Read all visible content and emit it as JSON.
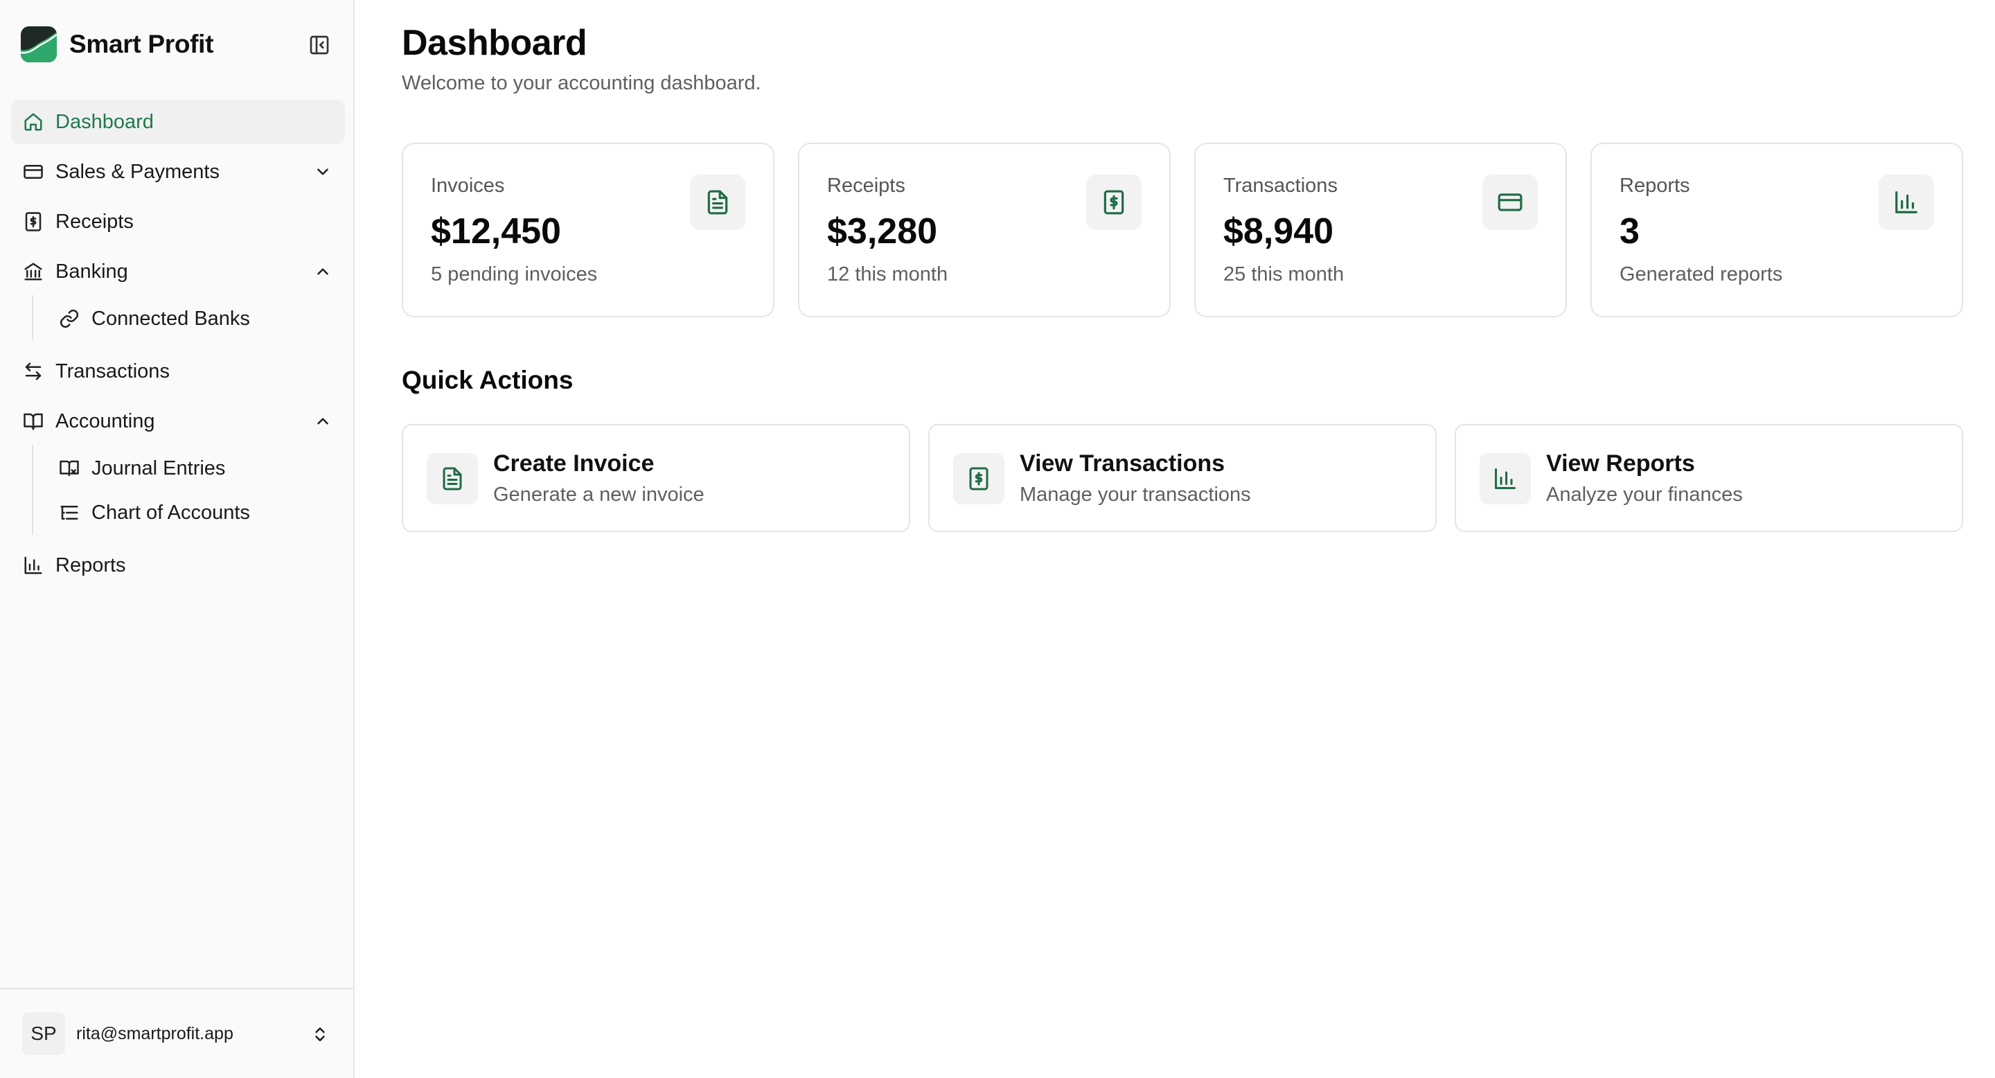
{
  "brand": {
    "name": "Smart Profit"
  },
  "colors": {
    "accent": "#1e7a4c",
    "icon": "#1e6b44",
    "border": "#e5e5e5"
  },
  "sidebar": {
    "items": [
      {
        "label": "Dashboard",
        "icon": "home-icon"
      },
      {
        "label": "Sales & Payments",
        "icon": "credit-card-icon"
      },
      {
        "label": "Receipts",
        "icon": "receipt-icon"
      },
      {
        "label": "Banking",
        "icon": "bank-icon"
      },
      {
        "label": "Connected Banks",
        "icon": "link-icon"
      },
      {
        "label": "Transactions",
        "icon": "arrows-exchange-icon"
      },
      {
        "label": "Accounting",
        "icon": "book-open-icon"
      },
      {
        "label": "Journal Entries",
        "icon": "book-icon"
      },
      {
        "label": "Chart of Accounts",
        "icon": "list-tree-icon"
      },
      {
        "label": "Reports",
        "icon": "bar-chart-icon"
      }
    ],
    "user": {
      "initials": "SP",
      "email": "rita@smartprofit.app"
    }
  },
  "main": {
    "title": "Dashboard",
    "subtitle": "Welcome to your accounting dashboard.",
    "stats": [
      {
        "label": "Invoices",
        "value": "$12,450",
        "sub": "5 pending invoices",
        "icon": "file-text-icon"
      },
      {
        "label": "Receipts",
        "value": "$3,280",
        "sub": "12 this month",
        "icon": "receipt-icon"
      },
      {
        "label": "Transactions",
        "value": "$8,940",
        "sub": "25 this month",
        "icon": "credit-card-icon"
      },
      {
        "label": "Reports",
        "value": "3",
        "sub": "Generated reports",
        "icon": "bar-chart-icon"
      }
    ],
    "quick_actions_title": "Quick Actions",
    "actions": [
      {
        "title": "Create Invoice",
        "sub": "Generate a new invoice",
        "icon": "file-text-icon"
      },
      {
        "title": "View Transactions",
        "sub": "Manage your transactions",
        "icon": "receipt-icon"
      },
      {
        "title": "View Reports",
        "sub": "Analyze your finances",
        "icon": "bar-chart-icon"
      }
    ]
  }
}
